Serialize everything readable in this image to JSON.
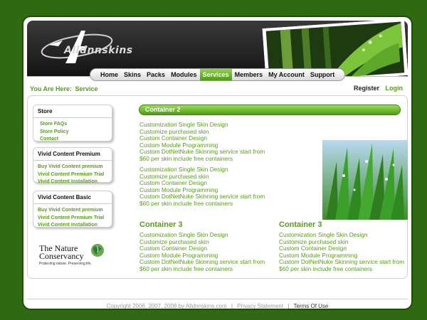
{
  "header": {
    "logo_text": "Alldnnskins"
  },
  "nav": {
    "items": [
      "Home",
      "Skins",
      "Packs",
      "Modules",
      "Services",
      "Members",
      "My Account",
      "Support"
    ],
    "active": "Services"
  },
  "breadcrumb": {
    "label": "You Are Here:",
    "current": "Service"
  },
  "auth": {
    "register": "Register",
    "login": "Login"
  },
  "sidebar": {
    "boxes": [
      {
        "title": "Store",
        "links": [
          "Store FAQs",
          "Store Policy",
          "Contact"
        ]
      },
      {
        "title": "Vivid Content Premium",
        "links": [
          "Buy Vivid Content premium",
          "Vivid Content Premium Trial",
          "Vivid Content Installation"
        ]
      },
      {
        "title": "Vivid Content Basic",
        "links": [
          "Buy Vivid Content premium",
          "Vivid Content Premium Trial",
          "Vivid Content Installation"
        ]
      }
    ]
  },
  "nature": {
    "name_line1": "The Nature",
    "name_line2": "Conservancy",
    "tagline": "Protecting nature. Preserving life."
  },
  "main": {
    "container2_title": "Container 2",
    "list_a": [
      "Customization Single Skin Design",
      "Customize purchased skin",
      "Custom Container Design",
      "Custom Module Programming",
      "Custom DotNetNuke Skinning service start from",
      "$60 per skin include free containers"
    ],
    "list_b": [
      "Customization Single Skin Design",
      "Customize purchased skin",
      "Custom Container Design",
      "Custom Module Programming",
      "Custom DotNetNuke Skinning service start from",
      "$60 per skin include free containers"
    ],
    "container3_left_title": "Container 3",
    "list_c": [
      "Customization Single Skin Design",
      "Customize purchased skin",
      "Custom Container Design",
      "Custom Module Programming",
      "Custom DotNetNuke Skinning service start from",
      "$60 per skin include free containers"
    ],
    "container3_right_title": "Container 3",
    "list_d": [
      "Customization Single Skin Design",
      "Customize purchased skin",
      "Custom Container Design",
      "Custom Module Programming",
      "Custom DotNetNuke Skinning service start from",
      "$60 per skin include free containers"
    ]
  },
  "footer": {
    "copyright": "Copyright 2006, 2007, 2008 by Alldnnskins.com",
    "sep": "|",
    "privacy": "Privacy Statement",
    "terms": "Terms Of Use"
  },
  "colors": {
    "accent": "#5a9c1c",
    "background": "#2f6a12",
    "header": "#1e1e1e"
  }
}
